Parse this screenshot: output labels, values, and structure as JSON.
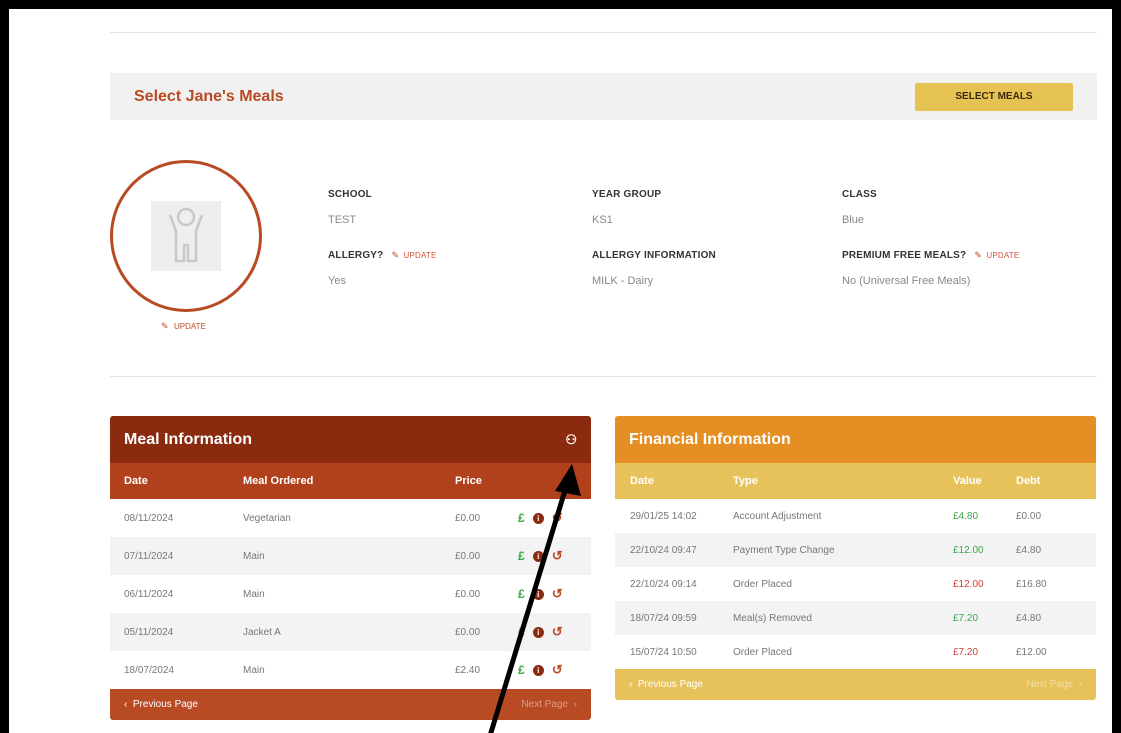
{
  "banner": {
    "title": "Select Jane's Meals",
    "button": "SELECT MEALS"
  },
  "profile": {
    "avatar_update": "UPDATE",
    "school_label": "SCHOOL",
    "school_value": "TEST",
    "year_label": "YEAR GROUP",
    "year_value": "KS1",
    "class_label": "CLASS",
    "class_value": "Blue",
    "allergy_label": "ALLERGY?",
    "allergy_update": "UPDATE",
    "allergy_value": "Yes",
    "allergy_info_label": "ALLERGY INFORMATION",
    "allergy_info_value": "MILK - Dairy",
    "premium_label": "PREMIUM FREE MEALS?",
    "premium_update": "UPDATE",
    "premium_value": "No (Universal Free Meals)"
  },
  "meal": {
    "title": "Meal Information",
    "columns": [
      "Date",
      "Meal Ordered",
      "Price"
    ],
    "rows": [
      {
        "date": "08/11/2024",
        "meal": "Vegetarian",
        "price": "£0.00"
      },
      {
        "date": "07/11/2024",
        "meal": "Main",
        "price": "£0.00"
      },
      {
        "date": "06/11/2024",
        "meal": "Main",
        "price": "£0.00"
      },
      {
        "date": "05/11/2024",
        "meal": "Jacket A",
        "price": "£0.00"
      },
      {
        "date": "18/07/2024",
        "meal": "Main",
        "price": "£2.40"
      }
    ],
    "prev": "Previous Page",
    "next": "Next Page"
  },
  "financial": {
    "title": "Financial Information",
    "columns": [
      "Date",
      "Type",
      "Value",
      "Debt"
    ],
    "rows": [
      {
        "date": "29/01/25 14:02",
        "type": "Account Adjustment",
        "value": "£4.80",
        "debt": "£0.00",
        "value_color": "green"
      },
      {
        "date": "22/10/24 09:47",
        "type": "Payment Type Change",
        "value": "£12.00",
        "debt": "£4.80",
        "value_color": "green"
      },
      {
        "date": "22/10/24 09:14",
        "type": "Order Placed",
        "value": "£12.00",
        "debt": "£16.80",
        "value_color": "red"
      },
      {
        "date": "18/07/24 09:59",
        "type": "Meal(s) Removed",
        "value": "£7.20",
        "debt": "£4.80",
        "value_color": "green"
      },
      {
        "date": "15/07/24 10:50",
        "type": "Order Placed",
        "value": "£7.20",
        "debt": "£12.00",
        "value_color": "red"
      }
    ],
    "prev": "Previous Page",
    "next": "Next Page"
  },
  "colors": {
    "brand": "#b84a24",
    "meal_header": "#8a2a0f",
    "fin_header": "#e48e23",
    "fin_cols": "#e7c25b",
    "button": "#e6c252"
  }
}
